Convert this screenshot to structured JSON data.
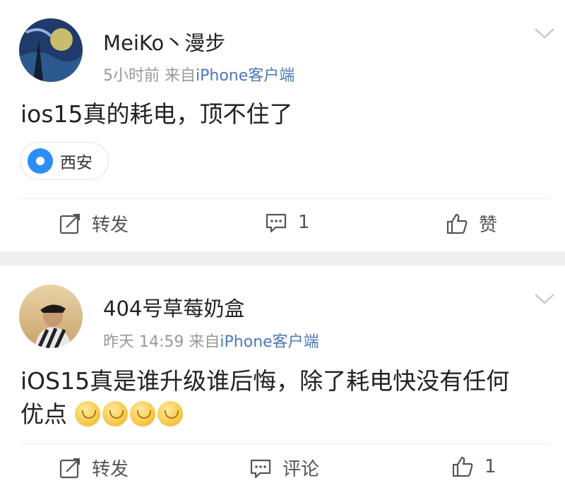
{
  "posts": [
    {
      "username": "MeiKo丶漫步",
      "time": "5小时前",
      "from": "来自",
      "source": "iPhone客户端",
      "content": "ios15真的耗电，顶不住了",
      "location": "西安",
      "actions": {
        "repost": "转发",
        "comment": "1",
        "like": "赞"
      }
    },
    {
      "username": "404号草莓奶盒",
      "time": "昨天 14:59",
      "from": "来自",
      "source": "iPhone客户端",
      "content_line1": "iOS15真是谁升级谁后悔，除了耗电快没有任何",
      "content_line2": "优点",
      "actions": {
        "repost": "转发",
        "comment": "评论",
        "like": "1"
      }
    }
  ],
  "colors": {
    "link": "#4c78b8",
    "meta": "#999999",
    "separator": "#efefef",
    "pin": "#2d8ff5"
  }
}
